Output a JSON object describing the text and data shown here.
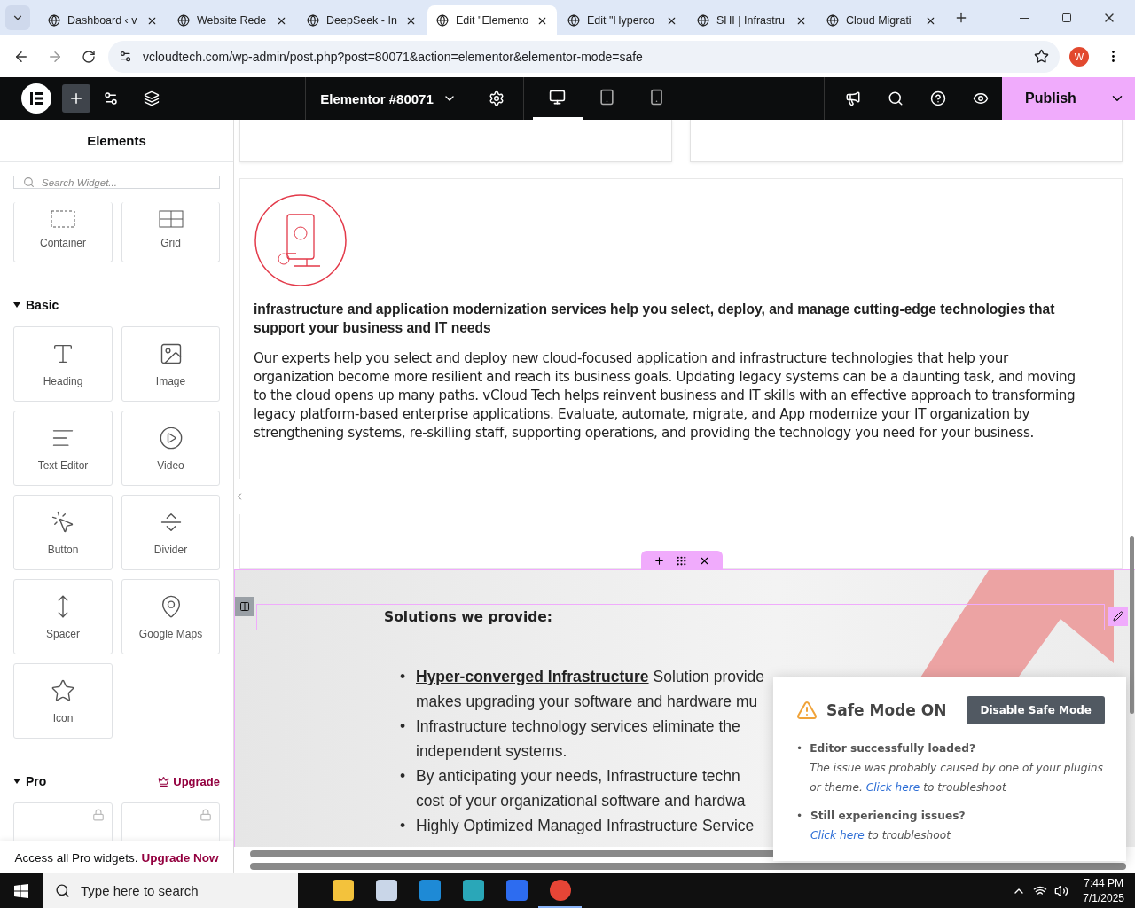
{
  "browser": {
    "tabs": [
      {
        "title": "Dashboard ‹ v",
        "selected": false
      },
      {
        "title": "Website Rede",
        "selected": false
      },
      {
        "title": "DeepSeek - In",
        "selected": false
      },
      {
        "title": "Edit \"Elemento",
        "selected": true
      },
      {
        "title": "Edit \"Hyperco",
        "selected": false
      },
      {
        "title": "SHI | Infrastru",
        "selected": false
      },
      {
        "title": "Cloud Migrati",
        "selected": false
      }
    ],
    "url": "vcloudtech.com/wp-admin/post.php?post=80071&action=elementor&elementor-mode=safe",
    "profile": "W"
  },
  "toolbar": {
    "document": "Elementor #80071",
    "devices": [
      {
        "selected": true
      },
      {
        "selected": false
      },
      {
        "selected": false
      }
    ],
    "publish": "Publish"
  },
  "panel": {
    "title": "Elements",
    "search_placeholder": "Search Widget...",
    "layout_widgets": [
      "Container",
      "Grid"
    ],
    "sections": [
      {
        "title": "Basic",
        "expanded": true,
        "widgets": [
          "Heading",
          "Image",
          "Text Editor",
          "Video",
          "Button",
          "Divider",
          "Spacer",
          "Google Maps",
          "Icon"
        ]
      },
      {
        "title": "Pro",
        "expanded": true,
        "action": "Upgrade"
      }
    ],
    "banner": {
      "text": "Access all Pro widgets.",
      "link": "Upgrade Now"
    }
  },
  "canvas": {
    "card": {
      "heading": "infrastructure and application modernization services help you select, deploy, and manage cutting-edge technologies that support your business and IT needs",
      "body": "Our experts help you select and deploy new cloud-focused application and infrastructure technologies that help your organization become more resilient and reach its business goals. Updating legacy systems can be a daunting task, and moving to the cloud opens up many paths. vCloud Tech helps reinvent business and IT skills with an effective approach to transforming legacy platform-based enterprise applications. Evaluate, automate, migrate, and App modernize your IT organization by strengthening systems, re-skilling staff, supporting operations, and providing the technology you need for your business."
    },
    "section": {
      "heading": "Solutions we provide:",
      "bullet": "•",
      "items": [
        {
          "link": "Hyper-converged Infrastructure",
          "lines": [
            "Solution provide",
            "makes upgrading your software and hardware mu"
          ]
        },
        {
          "lines": [
            "Infrastructure technology services eliminate the",
            "independent systems."
          ]
        },
        {
          "lines": [
            "By anticipating your needs, Infrastructure techn",
            "cost of your organizational software and hardwa"
          ]
        },
        {
          "lines": [
            "Highly Optimized Managed Infrastructure Service"
          ]
        }
      ]
    }
  },
  "safe_mode": {
    "title": "Safe Mode ON",
    "button": "Disable Safe Mode",
    "items": [
      {
        "question": "Editor successfully loaded?",
        "text": "The issue was probably caused by one of your plugins or theme.",
        "link": "Click here",
        "after": "to troubleshoot"
      },
      {
        "question": "Still experiencing issues?",
        "link": "Click here",
        "after": "to troubleshoot"
      }
    ]
  },
  "taskbar": {
    "search_placeholder": "Type here to search",
    "time": "7:44 PM",
    "date": "7/1/2025"
  }
}
